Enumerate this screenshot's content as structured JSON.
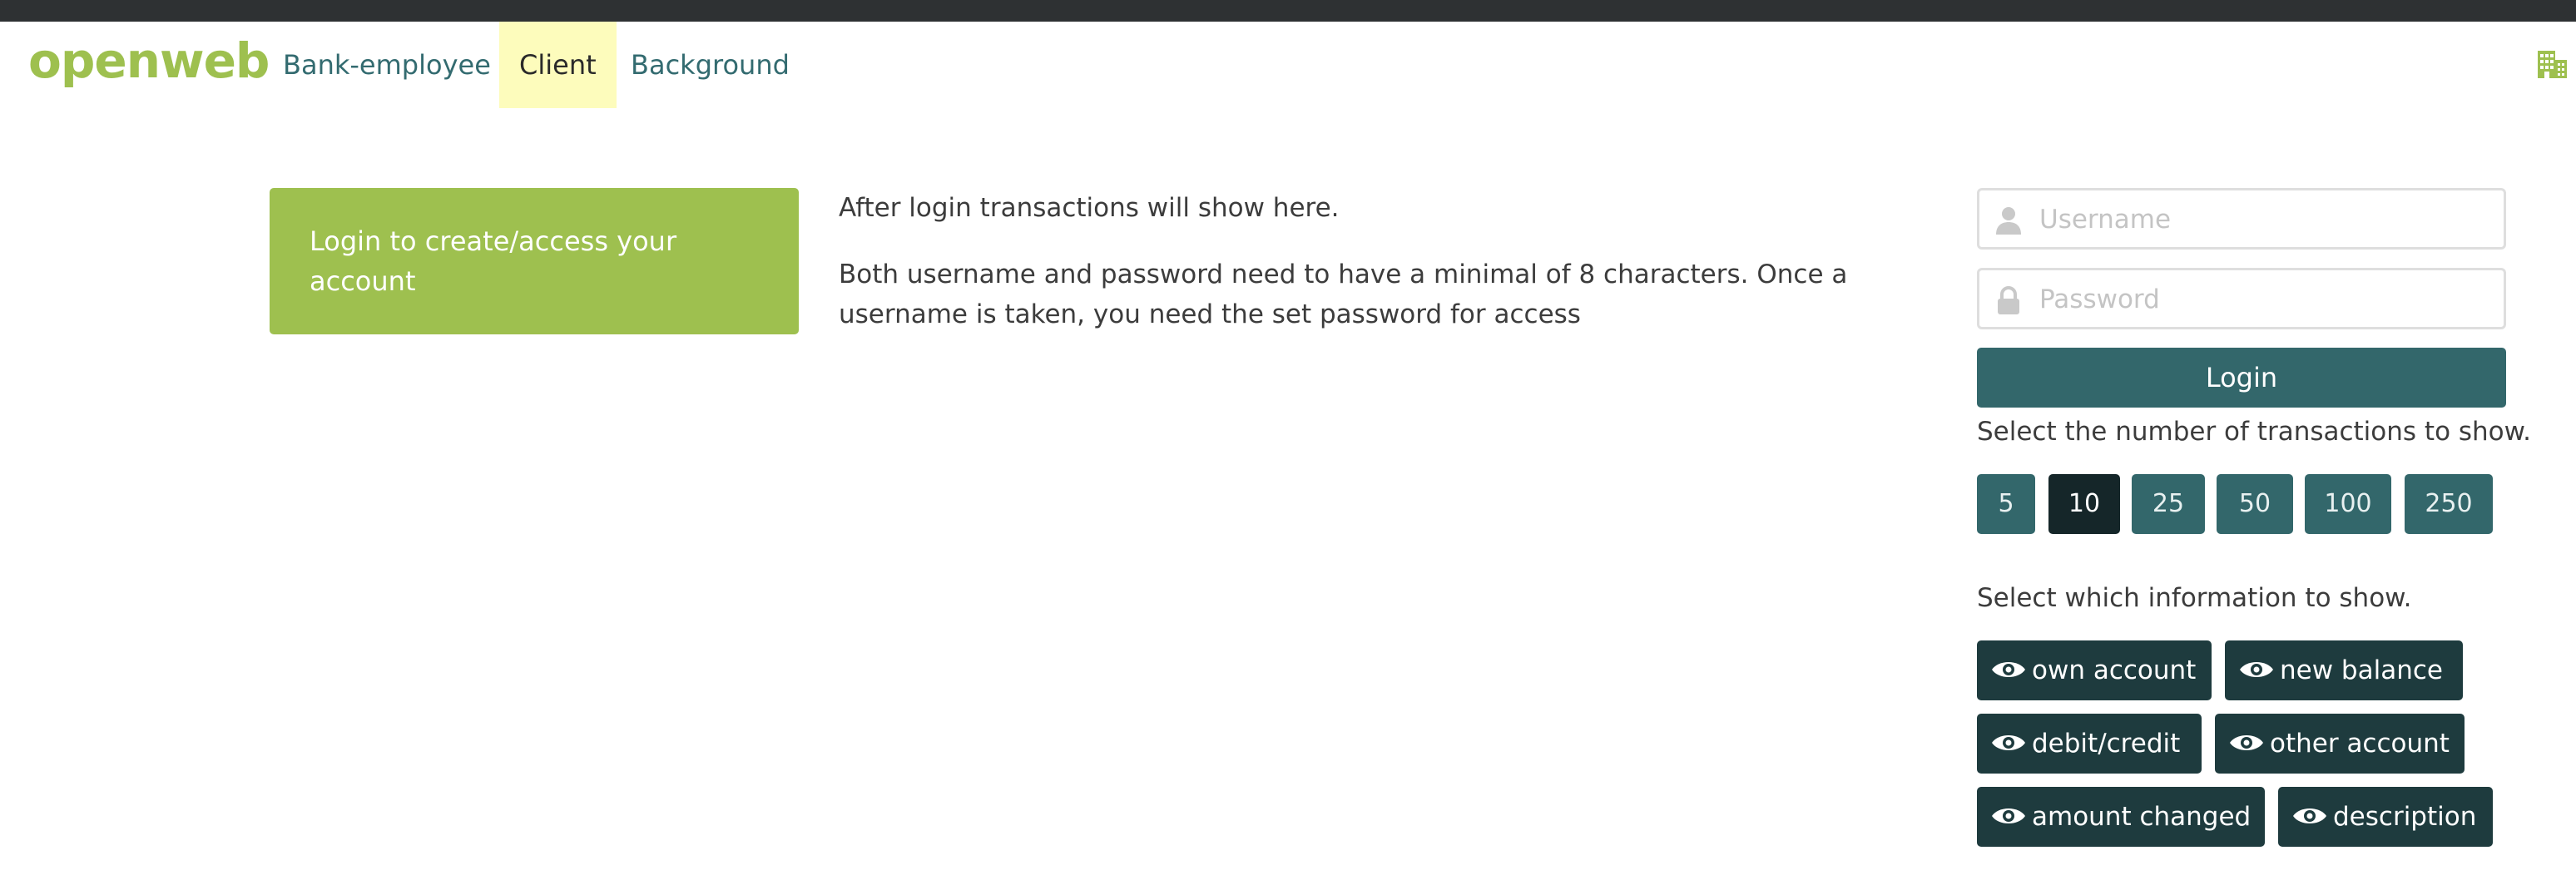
{
  "nav": {
    "brand": "openweb",
    "links": [
      {
        "label": "Bank-employee",
        "active": false
      },
      {
        "label": "Client",
        "active": true
      },
      {
        "label": "Background",
        "active": false
      }
    ],
    "right_icon": "building-icon"
  },
  "main": {
    "login_card_text": "Login to create/access your account",
    "info_paragraphs": [
      "After login transactions will show here.",
      "Both username and password need to have a minimal of 8 characters. Once a username is taken, you need the set password for access"
    ]
  },
  "sidebar": {
    "username": {
      "placeholder": "Username",
      "value": "",
      "icon": "user-icon"
    },
    "password": {
      "placeholder": "Password",
      "value": "",
      "icon": "lock-icon"
    },
    "login_label": "Login",
    "count_label": "Select the number of transactions to show.",
    "count_options": [
      "5",
      "10",
      "25",
      "50",
      "100",
      "250"
    ],
    "count_selected": "10",
    "info_label": "Select which information to show.",
    "info_options": [
      {
        "label": "own account",
        "icon": "eye-icon"
      },
      {
        "label": "new balance",
        "icon": "eye-icon"
      },
      {
        "label": "debit/credit",
        "icon": "eye-icon"
      },
      {
        "label": "other account",
        "icon": "eye-icon"
      },
      {
        "label": "amount changed",
        "icon": "eye-icon"
      },
      {
        "label": "description",
        "icon": "eye-icon"
      }
    ]
  },
  "colors": {
    "brand_green": "#9ec04f",
    "teal": "#33676b",
    "teal_dark": "#1e3b3e",
    "selected": "#152629",
    "active_tab": "#fdfcbc",
    "top_strip": "#2e3133"
  }
}
